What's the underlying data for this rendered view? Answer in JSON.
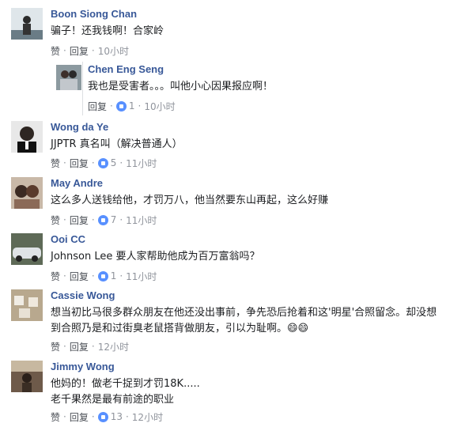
{
  "actions": {
    "like": "赞",
    "reply": "回复"
  },
  "comments": [
    {
      "name": "Boon Siong Chan",
      "text": "骗子！还我钱啊！合家岭",
      "time": "10小时"
    },
    {
      "name": "Chen Eng Seng",
      "text": "我也是受害者。。。叫他小心因果报应啊！",
      "likes": "1",
      "time": "10小时"
    },
    {
      "name": "Wong da Ye",
      "text": "JJPTR 真名叫（解决普通人）",
      "likes": "5",
      "time": "11小时"
    },
    {
      "name": "May Andre",
      "text": "这么多人送钱给他，才罚万八，他当然要东山再起，这么好赚",
      "likes": "7",
      "time": "11小时"
    },
    {
      "name": "Ooi CC",
      "text": "Johnson Lee 要人家帮助他成为百万富翁吗？",
      "likes": "1",
      "time": "11小时"
    },
    {
      "name": "Cassie Wong",
      "text1": "想当初比马很多群众朋友在他还没出事前，争先恐后抢着和这'明星'合照留念。却没想",
      "text2": "到合照乃是和过街臭老鼠搭背做朋友，引以为耻啊。😄😄",
      "time": "12小时"
    },
    {
      "name": "Jimmy Wong",
      "text1": "他妈的！做老千捉到才罚18K.....",
      "text2": "老千果然是最有前途的职业",
      "likes": "13",
      "time": "12小时"
    }
  ],
  "colors": {
    "name": "#385898",
    "meta": "#90949c",
    "like_badge": "#5890ff"
  }
}
